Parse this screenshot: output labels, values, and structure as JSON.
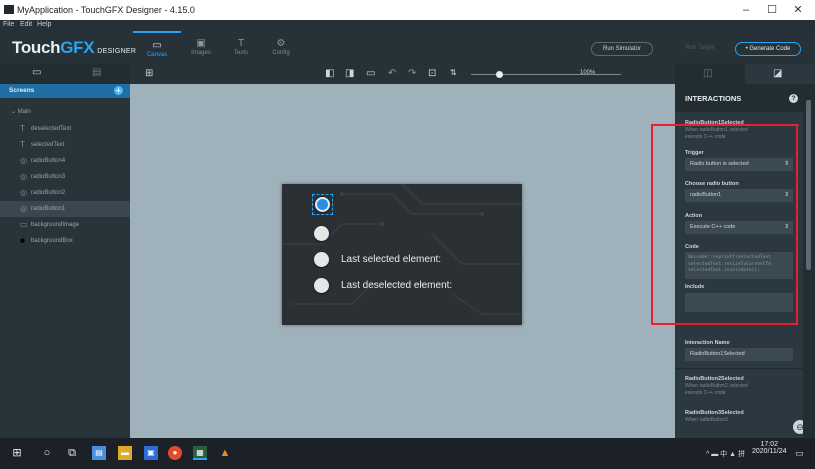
{
  "window": {
    "title": "MyApplication - TouchGFX Designer - 4.15.0",
    "minimize": "–",
    "maximize": "☐",
    "close": "✕"
  },
  "menu": [
    "File",
    "Edit",
    "Help"
  ],
  "brand": {
    "touch": "Touch",
    "gfx": "GF",
    "x": "X",
    "designer": "DESIGNER"
  },
  "nav_tabs": [
    {
      "label": "Canvas",
      "icon": "▭"
    },
    {
      "label": "Images",
      "icon": "▣"
    },
    {
      "label": "Texts",
      "icon": "T"
    },
    {
      "label": "Config",
      "icon": "⚙"
    }
  ],
  "topbar": {
    "run": "Run Simulator",
    "upload": "Run Target",
    "generate": "• Generate Code"
  },
  "left_panel": {
    "screens_label": "Screens",
    "add": "+",
    "root": "Main",
    "items": [
      {
        "label": "deselectedText",
        "icon": "T"
      },
      {
        "label": "selectedText",
        "icon": "T"
      },
      {
        "label": "radioButton4",
        "icon": "◎"
      },
      {
        "label": "radioButton3",
        "icon": "◎"
      },
      {
        "label": "radioButton2",
        "icon": "◎"
      },
      {
        "label": "radioButton1",
        "icon": "◎"
      },
      {
        "label": "backgroundImage",
        "icon": "▭"
      },
      {
        "label": "backgroundBox",
        "icon": "■"
      }
    ]
  },
  "toolbar": {
    "zoom": "100%"
  },
  "board": {
    "selected_label": "Last selected element:",
    "deselected_label": "Last deselected element:"
  },
  "interactions": {
    "title": "INTERACTIONS",
    "help": "?",
    "item1": {
      "name": "RadioButton1Selected",
      "desc1": "When radioButton1 selected",
      "desc2": "execute C++ code"
    },
    "trigger_label": "Trigger",
    "trigger_value": "Radio button is selected",
    "choose_label": "Choose radio button",
    "choose_value": "radioButton1",
    "action_label": "Action",
    "action_value": "Execute C++ code",
    "code_label": "Code",
    "code_lines": [
      "Unicode::snprintf(selectedText",
      "selectedText.resizeToCurrentTe",
      "selectedText.invalidate();"
    ],
    "include_label": "Include",
    "interaction_name_label": "Interaction Name",
    "interaction_name_value": "RadioButton1Selected",
    "item2": {
      "name": "RadioButton2Selected",
      "desc1": "When radioButton2 selected",
      "desc2": "execute C++ code"
    },
    "item3": {
      "name": "RadioButton3Selected",
      "desc1": "When radioButton3"
    }
  },
  "taskbar": {
    "time": "17:02",
    "date": "2020/11/24",
    "tray": "^ ▬ 中 ▲ 拼"
  },
  "accent": "#2aa3f3",
  "highlight": "#ea1f2a"
}
